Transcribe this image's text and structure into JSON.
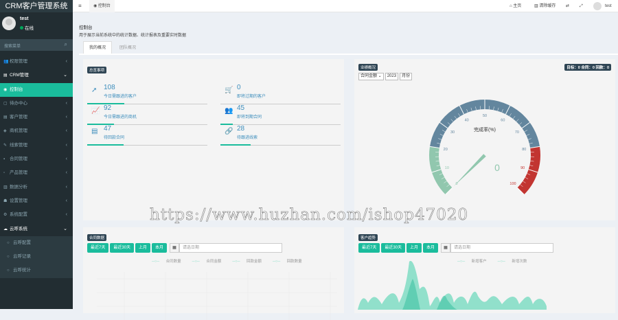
{
  "sidebar": {
    "brand": "CRM客户管理系统",
    "user": {
      "name": "test",
      "status": "在线"
    },
    "search_placeholder": "搜索菜单",
    "items": [
      {
        "icon": "users-icon",
        "glyph": "👥",
        "label": "权限管理",
        "arrow": "‹"
      },
      {
        "icon": "list-icon",
        "glyph": "▤",
        "label": "CRM管理",
        "arrow": "⌄"
      },
      {
        "icon": "dashboard-icon",
        "glyph": "◉",
        "label": "控制台",
        "arrow": ""
      },
      {
        "icon": "calendar-icon",
        "glyph": "▢",
        "label": "待办中心",
        "arrow": "‹"
      },
      {
        "icon": "customer-icon",
        "glyph": "▤",
        "label": "客户管理",
        "arrow": "‹"
      },
      {
        "icon": "opportunity-icon",
        "glyph": "◈",
        "label": "商机管理",
        "arrow": "‹"
      },
      {
        "icon": "lead-icon",
        "glyph": "✎",
        "label": "线索管理",
        "arrow": "‹"
      },
      {
        "icon": "contract-icon",
        "glyph": "▪",
        "label": "合同管理",
        "arrow": "‹"
      },
      {
        "icon": "product-icon",
        "glyph": "▫",
        "label": "产品管理",
        "arrow": "‹"
      },
      {
        "icon": "chart-icon",
        "glyph": "▥",
        "label": "数据分析",
        "arrow": "‹"
      },
      {
        "icon": "profile-icon",
        "glyph": "☗",
        "label": "设置管理",
        "arrow": "‹"
      },
      {
        "icon": "settings-icon",
        "glyph": "⚙",
        "label": "系统配置",
        "arrow": "‹"
      },
      {
        "icon": "cloud-icon",
        "glyph": "☁",
        "label": "云呼系统",
        "arrow": "⌄"
      }
    ],
    "subitems": [
      {
        "label": "云呼配置"
      },
      {
        "label": "云呼记录"
      },
      {
        "label": "云呼统计"
      }
    ]
  },
  "topbar": {
    "menu_glyph": "≡",
    "tab_label": "控制台",
    "home_label": "主页",
    "clear_cache_label": "清除缓存",
    "user_name": "test"
  },
  "header": {
    "title": "控制台",
    "description": "用于展示当前系统中的统计数据、统计报表及重要实时数据"
  },
  "tabs": [
    "我的概况",
    "团队概况"
  ],
  "overview": {
    "badge": "总览事项",
    "stats": [
      {
        "value": "108",
        "label": "今日需跟进的客户",
        "icon": "rocket-icon",
        "glyph": "➚",
        "progress": 0.31
      },
      {
        "value": "0",
        "label": "即将过期的客户",
        "icon": "cart-icon",
        "glyph": "🛒",
        "progress": 0
      },
      {
        "value": "92",
        "label": "今日需跟进的商机",
        "icon": "trend-icon",
        "glyph": "📈",
        "progress": 0.22
      },
      {
        "value": "45",
        "label": "即将到期合同",
        "icon": "group-icon",
        "glyph": "👥",
        "progress": 0.1
      },
      {
        "value": "47",
        "label": "待回款合同",
        "icon": "list-icon",
        "glyph": "▤",
        "progress": 0.3
      },
      {
        "value": "28",
        "label": "待跟进线索",
        "icon": "link-icon",
        "glyph": "🔗",
        "progress": 0.25
      }
    ]
  },
  "performance": {
    "badge": "业绩概况",
    "summary": "目标：0  合同：0  回款：0",
    "select_type": "合同金额",
    "select_year": "2023",
    "select_period": "月份",
    "gauge": {
      "label": "完成率(%)",
      "value": 0,
      "value_text": "0",
      "ticks": [
        "0",
        "10",
        "20",
        "30",
        "40",
        "50",
        "60",
        "70",
        "80",
        "90",
        "100"
      ]
    }
  },
  "contract_stats": {
    "badge": "合同数据",
    "buttons": [
      "最近7天",
      "最近30天",
      "上月",
      "本月"
    ],
    "date_placeholder": "请选日期",
    "legend": [
      "合同数量",
      "合同金额",
      "回款金额",
      "回款数量"
    ]
  },
  "customer_stats": {
    "badge": "客户趋势",
    "buttons": [
      "最近7天",
      "最近30天",
      "上月",
      "本月"
    ],
    "date_placeholder": "请选日期",
    "legend": [
      "新增客户",
      "新增次数"
    ]
  },
  "watermark": "https://www.huzhan.com/ishop47020",
  "colors": {
    "accent": "#1abc9c",
    "sidebar": "#222d32",
    "gauge_low": "#91c7ae",
    "gauge_mid": "#63869e",
    "gauge_high": "#c23531"
  }
}
